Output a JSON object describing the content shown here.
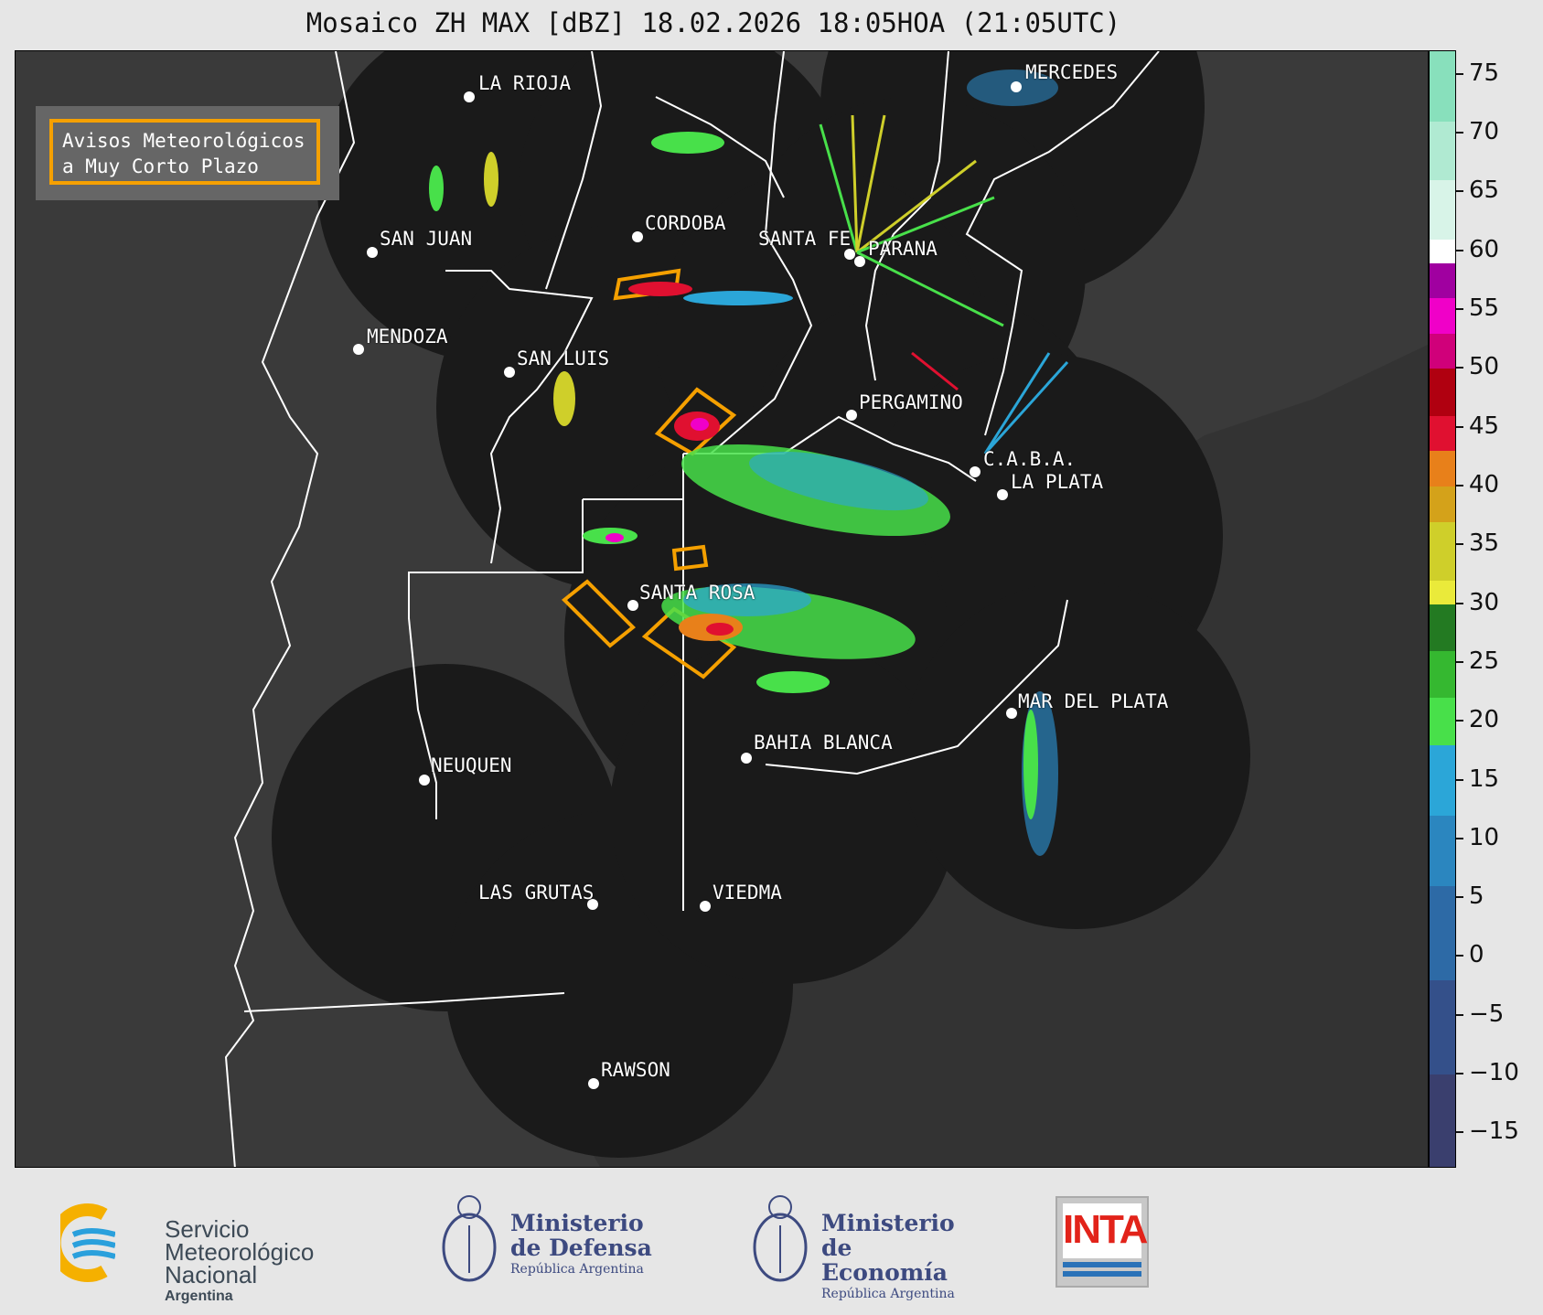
{
  "title": "Mosaico ZH MAX [dBZ] 18.02.2026 18:05HOA (21:05UTC)",
  "legend": {
    "line1": "Avisos Meteorológicos",
    "line2": "a Muy Corto Plazo",
    "border_color": "#f5a000"
  },
  "colorbar": {
    "ticks": [
      "75",
      "70",
      "65",
      "60",
      "55",
      "50",
      "45",
      "40",
      "35",
      "30",
      "25",
      "20",
      "15",
      "10",
      "5",
      "0",
      "−5",
      "−10",
      "−15"
    ],
    "range": [
      -18,
      77
    ],
    "stops": [
      {
        "from": -18,
        "to": -10,
        "color": "#3a3f6e"
      },
      {
        "from": -10,
        "to": -2,
        "color": "#34508a"
      },
      {
        "from": -2,
        "to": 6,
        "color": "#2d6aa6"
      },
      {
        "from": 6,
        "to": 12,
        "color": "#2b86bf"
      },
      {
        "from": 12,
        "to": 18,
        "color": "#2ba6d8"
      },
      {
        "from": 18,
        "to": 22,
        "color": "#48e04a"
      },
      {
        "from": 22,
        "to": 26,
        "color": "#35b830"
      },
      {
        "from": 26,
        "to": 30,
        "color": "#237a22"
      },
      {
        "from": 30,
        "to": 32,
        "color": "#eaea3a"
      },
      {
        "from": 32,
        "to": 37,
        "color": "#cfcf2a"
      },
      {
        "from": 37,
        "to": 40,
        "color": "#d4a21a"
      },
      {
        "from": 40,
        "to": 43,
        "color": "#e8801a"
      },
      {
        "from": 43,
        "to": 46,
        "color": "#e01030"
      },
      {
        "from": 46,
        "to": 50,
        "color": "#b00010"
      },
      {
        "from": 50,
        "to": 53,
        "color": "#d0007a"
      },
      {
        "from": 53,
        "to": 56,
        "color": "#f000c8"
      },
      {
        "from": 56,
        "to": 59,
        "color": "#a000a0"
      },
      {
        "from": 59,
        "to": 61,
        "color": "#ffffff"
      },
      {
        "from": 61,
        "to": 66,
        "color": "#d8f4e8"
      },
      {
        "from": 66,
        "to": 71,
        "color": "#b0ead2"
      },
      {
        "from": 71,
        "to": 77,
        "color": "#88e0bc"
      }
    ]
  },
  "cities": [
    {
      "name": "LA RIOJA"
    },
    {
      "name": "CORDOBA"
    },
    {
      "name": "SAN JUAN"
    },
    {
      "name": "SANTA FE"
    },
    {
      "name": "PARANA"
    },
    {
      "name": "MENDOZA"
    },
    {
      "name": "SAN LUIS"
    },
    {
      "name": "PERGAMINO"
    },
    {
      "name": "C.A.B.A."
    },
    {
      "name": "LA PLATA"
    },
    {
      "name": "SANTA ROSA"
    },
    {
      "name": "MAR DEL PLATA"
    },
    {
      "name": "BAHIA BLANCA"
    },
    {
      "name": "NEUQUEN"
    },
    {
      "name": "LAS GRUTAS"
    },
    {
      "name": "VIEDMA"
    },
    {
      "name": "RAWSON"
    },
    {
      "name": "MERCEDES"
    }
  ],
  "footer": {
    "smn": {
      "line1": "Servicio",
      "line2": "Meteorológico",
      "line3": "Nacional",
      "line4": "Argentina"
    },
    "defensa": {
      "line1": "Ministerio",
      "line2": "de Defensa",
      "line3": "República Argentina"
    },
    "economia": {
      "line1": "Ministerio",
      "line2": "de Economía",
      "line3": "República Argentina"
    },
    "inta": {
      "text": "INTA"
    }
  }
}
